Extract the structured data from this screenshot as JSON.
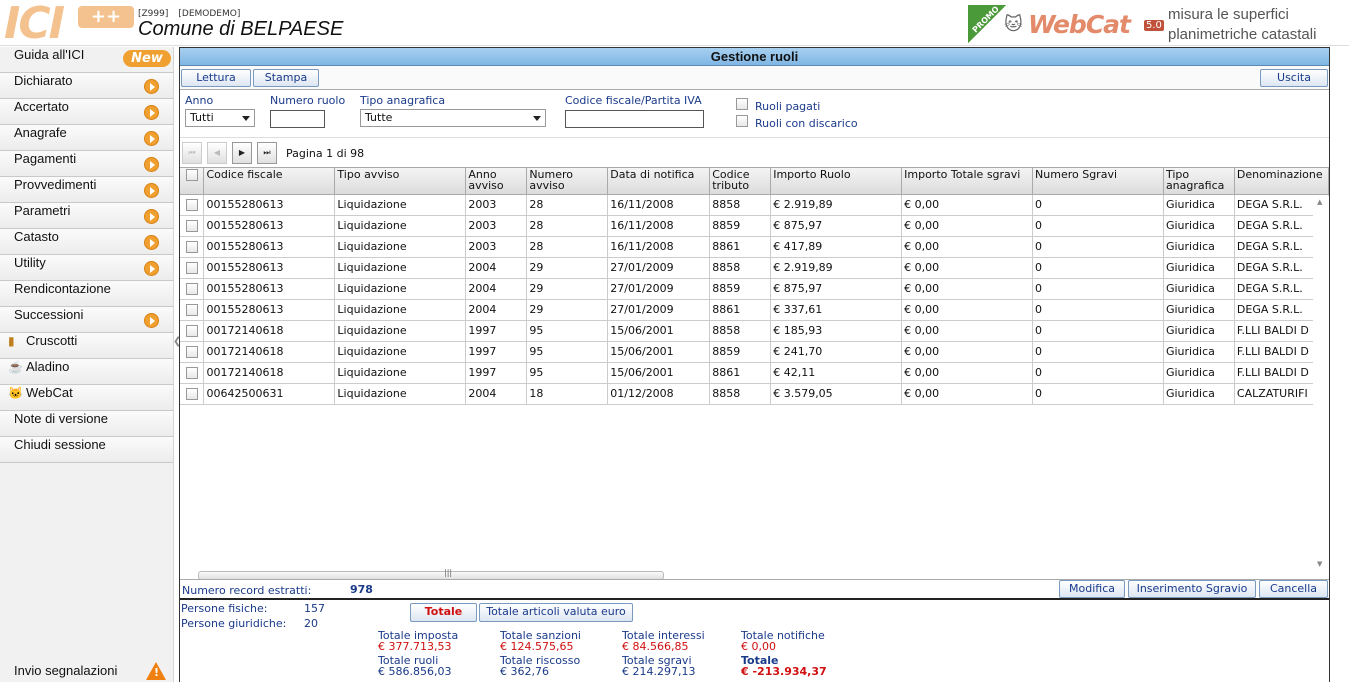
{
  "header": {
    "ente_code": "[Z999]",
    "ente_user": "[DEMODEMO]",
    "ente_name": "Comune di BELPAESE",
    "logo_text": "ICI",
    "logo_plus": "++",
    "promo_badge": "PROMO",
    "webcat_logo": "WebCat",
    "webcat_version": "5.0",
    "promo_line1": "misura le superfici",
    "promo_line2": "planimetriche catastali"
  },
  "nav": {
    "items": [
      {
        "label": "Guida all'ICI",
        "badge": "New"
      },
      {
        "label": "Dichiarato"
      },
      {
        "label": "Accertato"
      },
      {
        "label": "Anagrafe"
      },
      {
        "label": "Pagamenti"
      },
      {
        "label": "Provvedimenti"
      },
      {
        "label": "Parametri"
      },
      {
        "label": "Catasto"
      },
      {
        "label": "Utility"
      },
      {
        "label": "Rendicontazione"
      },
      {
        "label": "Successioni"
      },
      {
        "label": "Cruscotti"
      },
      {
        "label": "Aladino"
      },
      {
        "label": "WebCat"
      },
      {
        "label": "Note di versione"
      },
      {
        "label": "Chiudi sessione"
      }
    ],
    "footer_label": "Invio segnalazioni"
  },
  "panel": {
    "title": "Gestione ruoli",
    "toolbar": {
      "lettura": "Lettura",
      "stampa": "Stampa",
      "uscita": "Uscita"
    },
    "filters": {
      "anno_label": "Anno",
      "anno_value": "Tutti",
      "numero_ruolo_label": "Numero ruolo",
      "numero_ruolo_value": "",
      "tipo_anagrafica_label": "Tipo anagrafica",
      "tipo_anagrafica_value": "Tutte",
      "codice_fiscale_label": "Codice fiscale/Partita IVA",
      "codice_fiscale_value": "",
      "ruoli_pagati_label": "Ruoli pagati",
      "ruoli_discarico_label": "Ruoli con discarico"
    },
    "pager": {
      "info": "Pagina 1 di 98"
    },
    "grid": {
      "columns": [
        "Codice fiscale",
        "Tipo avviso",
        "Anno avviso",
        "Numero avviso",
        "Data di notifica",
        "Codice tributo",
        "Importo Ruolo",
        "Importo Totale sgravi",
        "Numero Sgravi",
        "Tipo anagrafica",
        "Denominazione"
      ],
      "rows": [
        [
          "00155280613",
          "Liquidazione",
          "2003",
          "28",
          "16/11/2008",
          "8858",
          "€ 2.919,89",
          "€ 0,00",
          "0",
          "Giuridica",
          "DEGA S.R.L."
        ],
        [
          "00155280613",
          "Liquidazione",
          "2003",
          "28",
          "16/11/2008",
          "8859",
          "€ 875,97",
          "€ 0,00",
          "0",
          "Giuridica",
          "DEGA S.R.L."
        ],
        [
          "00155280613",
          "Liquidazione",
          "2003",
          "28",
          "16/11/2008",
          "8861",
          "€ 417,89",
          "€ 0,00",
          "0",
          "Giuridica",
          "DEGA S.R.L."
        ],
        [
          "00155280613",
          "Liquidazione",
          "2004",
          "29",
          "27/01/2009",
          "8858",
          "€ 2.919,89",
          "€ 0,00",
          "0",
          "Giuridica",
          "DEGA S.R.L."
        ],
        [
          "00155280613",
          "Liquidazione",
          "2004",
          "29",
          "27/01/2009",
          "8859",
          "€ 875,97",
          "€ 0,00",
          "0",
          "Giuridica",
          "DEGA S.R.L."
        ],
        [
          "00155280613",
          "Liquidazione",
          "2004",
          "29",
          "27/01/2009",
          "8861",
          "€ 337,61",
          "€ 0,00",
          "0",
          "Giuridica",
          "DEGA S.R.L."
        ],
        [
          "00172140618",
          "Liquidazione",
          "1997",
          "95",
          "15/06/2001",
          "8858",
          "€ 185,93",
          "€ 0,00",
          "0",
          "Giuridica",
          "F.LLI BALDI D"
        ],
        [
          "00172140618",
          "Liquidazione",
          "1997",
          "95",
          "15/06/2001",
          "8859",
          "€ 241,70",
          "€ 0,00",
          "0",
          "Giuridica",
          "F.LLI BALDI D"
        ],
        [
          "00172140618",
          "Liquidazione",
          "1997",
          "95",
          "15/06/2001",
          "8861",
          "€ 42,11",
          "€ 0,00",
          "0",
          "Giuridica",
          "F.LLI BALDI D"
        ],
        [
          "00642500631",
          "Liquidazione",
          "2004",
          "18",
          "01/12/2008",
          "8858",
          "€ 3.579,05",
          "€ 0,00",
          "0",
          "Giuridica",
          "CALZATURIFI"
        ]
      ]
    },
    "footer": {
      "record_label": "Numero record estratti:",
      "record_count": "978",
      "modifica": "Modifica",
      "inserimento": "Inserimento Sgravio",
      "cancella": "Cancella"
    },
    "summary": {
      "persone_fisiche_label": "Persone fisiche:",
      "persone_fisiche": "157",
      "persone_giuridiche_label": "Persone giuridiche:",
      "persone_giuridiche": "20",
      "btn_totale": "Totale",
      "btn_totale_euro": "Totale articoli valuta euro",
      "totale_imposta_label": "Totale imposta",
      "totale_imposta": "€ 377.713,53",
      "totale_sanzioni_label": "Totale sanzioni",
      "totale_sanzioni": "€ 124.575,65",
      "totale_interessi_label": "Totale interessi",
      "totale_interessi": "€ 84.566,85",
      "totale_notifiche_label": "Totale notifiche",
      "totale_notifiche": "€ 0,00",
      "totale_ruoli_label": "Totale ruoli",
      "totale_ruoli": "€ 586.856,03",
      "totale_riscosso_label": "Totale riscosso",
      "totale_riscosso": "€ 362,76",
      "totale_sgravi_label": "Totale sgravi",
      "totale_sgravi": "€ 214.297,13",
      "totale_label": "Totale",
      "totale": "€ -213.934,37"
    }
  }
}
